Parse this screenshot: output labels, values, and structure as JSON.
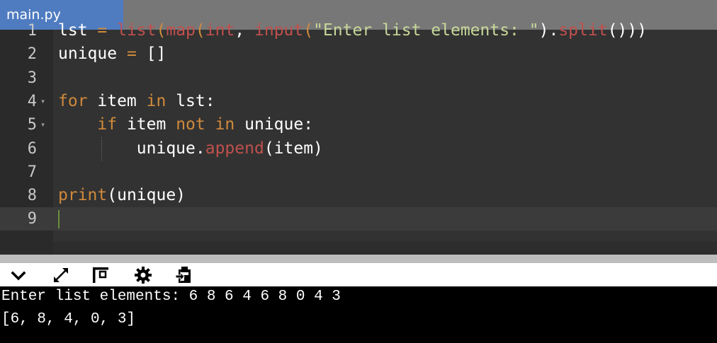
{
  "tab": {
    "label": "main.py"
  },
  "editor": {
    "line_numbers": [
      "1",
      "2",
      "3",
      "4",
      "5",
      "6",
      "7",
      "8",
      "9"
    ],
    "lines": [
      [
        {
          "t": "lst ",
          "c": "pl"
        },
        {
          "t": "= ",
          "c": "kw"
        },
        {
          "t": "list",
          "c": "fn"
        },
        {
          "t": "(",
          "c": "kw"
        },
        {
          "t": "map",
          "c": "fn"
        },
        {
          "t": "(",
          "c": "kw"
        },
        {
          "t": "int",
          "c": "fn"
        },
        {
          "t": ", ",
          "c": "pl"
        },
        {
          "t": "input",
          "c": "fn"
        },
        {
          "t": "(",
          "c": "kw"
        },
        {
          "t": "\"Enter list elements: \"",
          "c": "str"
        },
        {
          "t": ").",
          "c": "pl"
        },
        {
          "t": "split",
          "c": "fn"
        },
        {
          "t": "()))",
          "c": "pl"
        }
      ],
      [
        {
          "t": "unique ",
          "c": "pl"
        },
        {
          "t": "= ",
          "c": "kw"
        },
        {
          "t": "[]",
          "c": "pl"
        }
      ],
      [],
      [
        {
          "t": "for ",
          "c": "kw"
        },
        {
          "t": "item ",
          "c": "pl"
        },
        {
          "t": "in ",
          "c": "kw"
        },
        {
          "t": "lst:",
          "c": "pl"
        }
      ],
      [
        {
          "t": "    ",
          "c": "pl"
        },
        {
          "t": "if ",
          "c": "kw"
        },
        {
          "t": "item ",
          "c": "pl"
        },
        {
          "t": "not ",
          "c": "kw"
        },
        {
          "t": "in ",
          "c": "kw"
        },
        {
          "t": "unique:",
          "c": "pl"
        }
      ],
      [
        {
          "t": "        unique.",
          "c": "pl"
        },
        {
          "t": "append",
          "c": "fn"
        },
        {
          "t": "(item)",
          "c": "pl"
        }
      ],
      [],
      [
        {
          "t": "print",
          "c": "kw"
        },
        {
          "t": "(unique)",
          "c": "pl"
        }
      ],
      []
    ]
  },
  "toolbar": {
    "icons": [
      "chevron-down-icon",
      "expand-icon",
      "layout-icon",
      "gear-icon",
      "clipboard-icon"
    ]
  },
  "console": {
    "lines": [
      "Enter list elements: 6 8 6 4 6 8 0 4 3",
      "[6, 8, 4, 0, 3]"
    ]
  },
  "colors": {
    "tab_bg": "#4f7cc0",
    "keyword": "#d08a3c",
    "function": "#c0504d",
    "string": "#c7d89a"
  }
}
